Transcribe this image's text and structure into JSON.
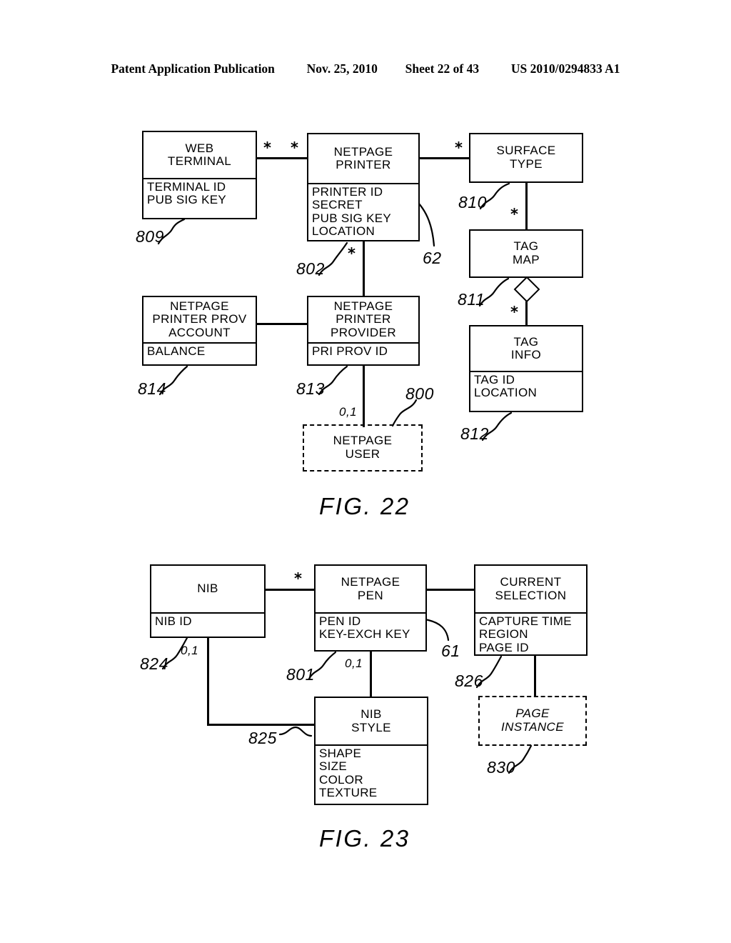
{
  "header": {
    "publication": "Patent Application Publication",
    "date": "Nov. 25, 2010",
    "sheet": "Sheet 22 of 43",
    "patent_number": "US 2010/0294833 A1"
  },
  "figures": [
    {
      "id": "fig22",
      "caption": "FIG. 22"
    },
    {
      "id": "fig23",
      "caption": "FIG. 23"
    }
  ],
  "fig22": {
    "caption": "FIG. 22",
    "entities": [
      {
        "name": "web-terminal",
        "title": "WEB\nTERMINAL",
        "attributes": "TERMINAL ID\nPUB SIG KEY",
        "ref": "809"
      },
      {
        "name": "netpage-printer",
        "title": "NETPAGE\nPRINTER",
        "attributes": "PRINTER ID\nSECRET\nPUB SIG KEY\nLOCATION",
        "ref": "802",
        "callout_ref": "62"
      },
      {
        "name": "surface-type",
        "title": "SURFACE\nTYPE",
        "attributes": "",
        "ref": "810"
      },
      {
        "name": "tag-map",
        "title": "TAG\nMAP",
        "attributes": "",
        "ref": "811"
      },
      {
        "name": "tag-info",
        "title": "TAG\nINFO",
        "attributes": "TAG ID\nLOCATION",
        "ref": "812"
      },
      {
        "name": "netpage-printer-prov-account",
        "title": "NETPAGE\nPRINTER PROV\nACCOUNT",
        "attributes": "BALANCE",
        "ref": "814"
      },
      {
        "name": "netpage-printer-provider",
        "title": "NETPAGE\nPRINTER\nPROVIDER",
        "attributes": "PRI PROV ID",
        "ref": "813"
      },
      {
        "name": "netpage-user",
        "title": "NETPAGE\nUSER",
        "attributes": "",
        "ref": "800",
        "style": "dashed"
      }
    ],
    "multiplicities": [
      {
        "name": "web-terminal-to-printer-left",
        "label": "*"
      },
      {
        "name": "web-terminal-to-printer-right",
        "label": "*"
      },
      {
        "name": "printer-to-surface-type",
        "label": "*"
      },
      {
        "name": "surface-type-to-tag-map",
        "label": "*"
      },
      {
        "name": "tag-map-to-tag-info",
        "label": "*"
      },
      {
        "name": "printer-to-provider",
        "label": "*"
      },
      {
        "name": "provider-to-user",
        "label": "0,1"
      }
    ]
  },
  "fig23": {
    "caption": "FIG. 23",
    "entities": [
      {
        "name": "nib",
        "title": "NIB",
        "attributes": "NIB ID",
        "ref": "824"
      },
      {
        "name": "netpage-pen",
        "title": "NETPAGE\nPEN",
        "attributes": "PEN ID\nKEY-EXCH KEY",
        "ref": "801",
        "callout_ref": "61"
      },
      {
        "name": "current-selection",
        "title": "CURRENT\nSELECTION",
        "attributes": "CAPTURE TIME\nREGION\nPAGE ID",
        "ref": "826"
      },
      {
        "name": "nib-style",
        "title": "NIB\nSTYLE",
        "attributes": "SHAPE\nSIZE\nCOLOR\nTEXTURE",
        "ref": "825"
      },
      {
        "name": "page-instance",
        "title": "PAGE\nINSTANCE",
        "attributes": "",
        "ref": "830",
        "style": "dashed-italic"
      }
    ],
    "multiplicities": [
      {
        "name": "nib-to-pen",
        "label": "*"
      },
      {
        "name": "nib-to-nib-style",
        "label": "0,1"
      },
      {
        "name": "pen-to-nib-style",
        "label": "0,1"
      }
    ]
  }
}
